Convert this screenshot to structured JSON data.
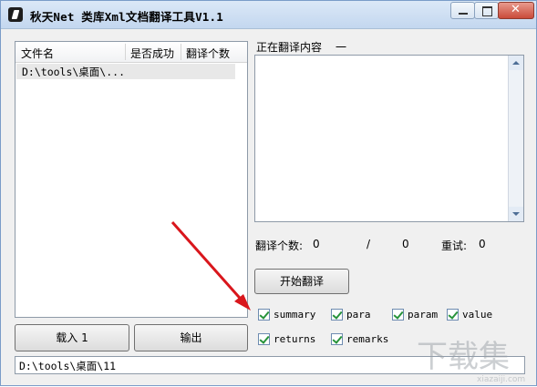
{
  "window": {
    "title": "秋天Net 类库Xml文档翻译工具V1.1"
  },
  "list": {
    "columns": [
      "文件名",
      "是否成功",
      "翻译个数"
    ],
    "rows": [
      {
        "file": "D:\\tools\\桌面\\..."
      }
    ]
  },
  "right": {
    "translating_label": "正在翻译内容",
    "translating_value": "一",
    "stats": {
      "count_label": "翻译个数:",
      "count": "0",
      "slash": "/",
      "total": "0",
      "retry_label": "重试:",
      "retry": "0"
    },
    "start_button": "开始翻译"
  },
  "checkboxes": [
    {
      "label": "summary",
      "checked": true
    },
    {
      "label": "para",
      "checked": true
    },
    {
      "label": "param",
      "checked": true
    },
    {
      "label": "value",
      "checked": true
    },
    {
      "label": "returns",
      "checked": true
    },
    {
      "label": "remarks",
      "checked": true
    }
  ],
  "bottom_buttons": {
    "load": "载入 1",
    "export": "输出"
  },
  "status": {
    "path": "D:\\tools\\桌面\\11"
  },
  "annotation": {
    "color": "#d9161c"
  },
  "watermark": {
    "text": "下载集",
    "sub": "xiazaiji.com"
  }
}
